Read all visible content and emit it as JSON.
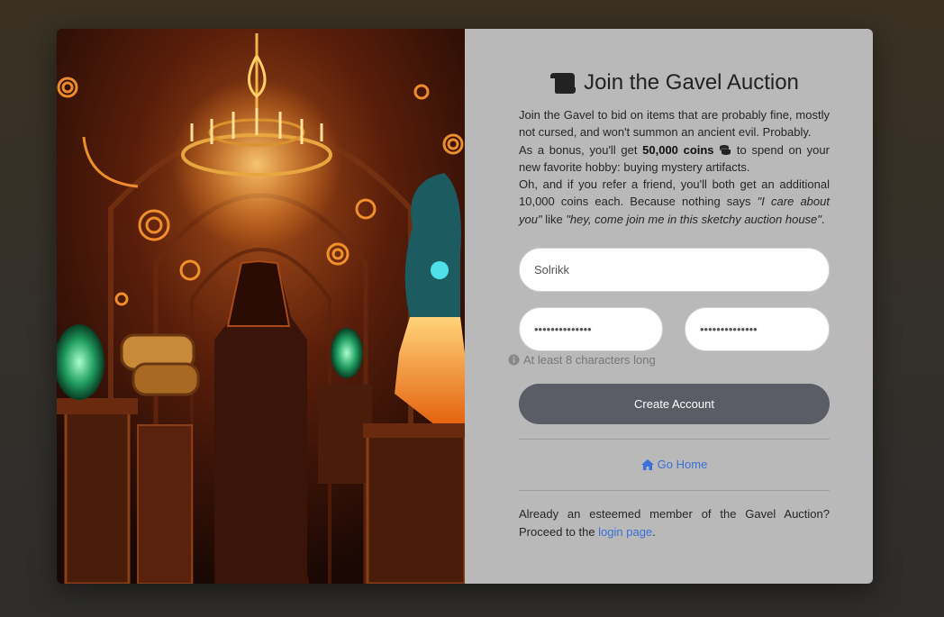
{
  "title": "Join the Gavel Auction",
  "icons": {
    "title": "scroll-icon",
    "coins": "coins-icon",
    "info": "info-circle-icon",
    "home": "home-icon"
  },
  "intro": {
    "line1": "Join the Gavel to bid on items that are probably fine, mostly not cursed, and won't summon an ancient evil. Probably.",
    "bonus_pre": "As a bonus, you'll get ",
    "bonus_amount": "50,000 coins",
    "bonus_post": " to spend on your new favorite hobby: buying mystery artifacts.",
    "refer_pre": "Oh, and if you refer a friend, you'll both get an additional 10,000 coins each. Because nothing says ",
    "refer_quote1": "\"I care about you\"",
    "refer_mid": " like ",
    "refer_quote2": "\"hey, come join me in this sketchy auction house\"",
    "refer_end": "."
  },
  "form": {
    "username_value": "Solrikk",
    "password_value": "••••••••••••••",
    "confirm_value": "••••••••••••••",
    "hint": "At least 8 characters long",
    "submit_label": "Create Account"
  },
  "home_link": "Go Home",
  "footer": {
    "text": "Already an esteemed member of the Gavel Auction? Proceed to the ",
    "link": "login page",
    "end": "."
  },
  "colors": {
    "panel": "#b9b9b9",
    "button": "#5a5c66",
    "link": "#3c6fd8"
  }
}
